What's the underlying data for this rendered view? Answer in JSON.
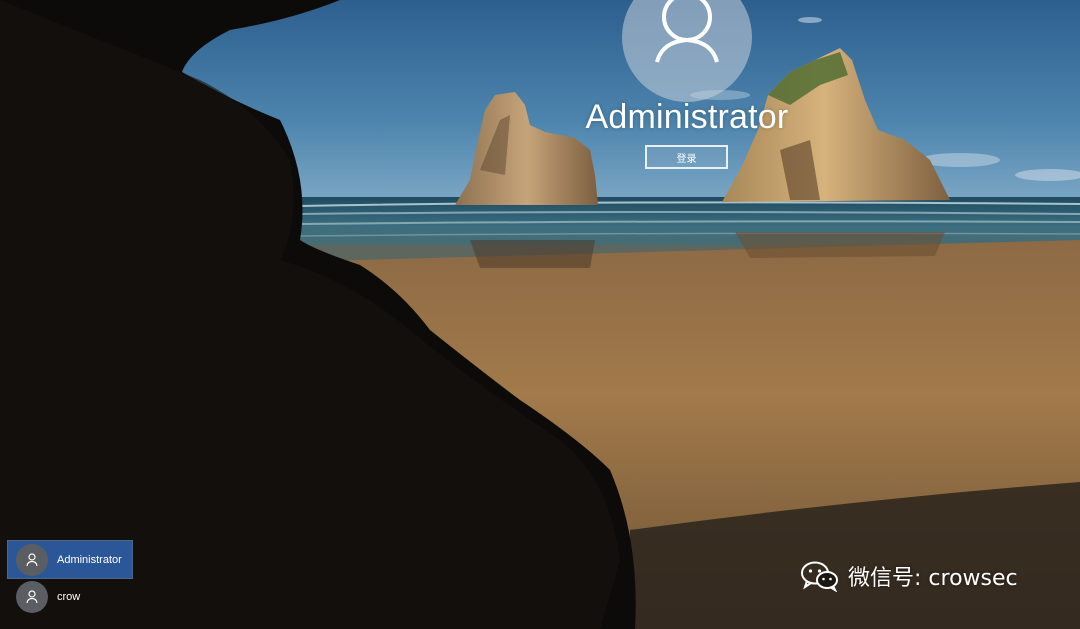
{
  "login": {
    "current_user": "Administrator",
    "signin_label": "登录"
  },
  "user_list": [
    {
      "name": "Administrator",
      "selected": true
    },
    {
      "name": "crow",
      "selected": false
    }
  ],
  "watermark": {
    "text": "微信号: crowsec",
    "icon": "wechat-icon"
  },
  "colors": {
    "selected_user_bg": "#2b5798",
    "avatar_bg": "#5a5d62"
  }
}
